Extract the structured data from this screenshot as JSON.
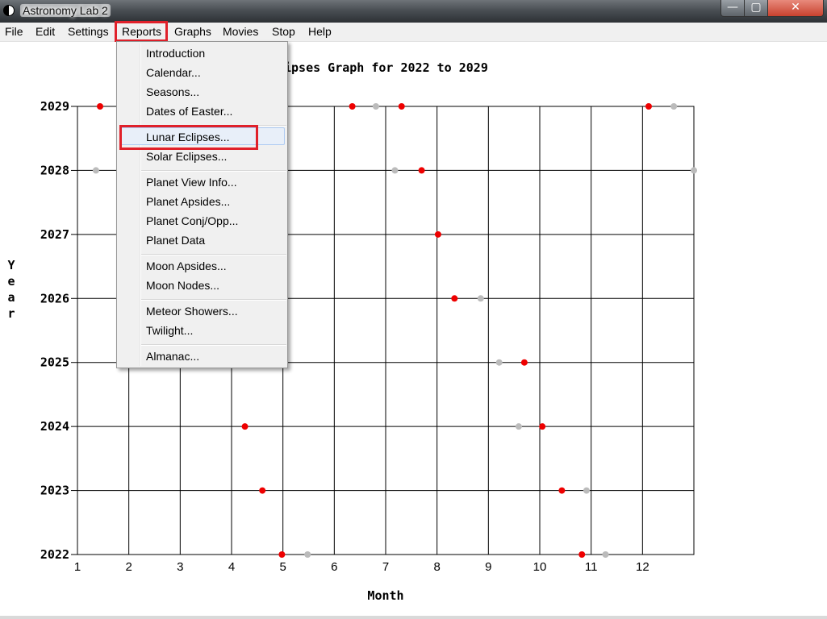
{
  "window": {
    "title": "Astronomy Lab 2",
    "minimize_glyph": "—",
    "maximize_glyph": "▢",
    "close_glyph": "✕"
  },
  "menubar": {
    "items": [
      "File",
      "Edit",
      "Settings",
      "Reports",
      "Graphs",
      "Movies",
      "Stop",
      "Help"
    ],
    "active": "Reports"
  },
  "reports_menu": {
    "groups": [
      [
        "Introduction",
        "Calendar...",
        "Seasons...",
        "Dates of Easter..."
      ],
      [
        "Lunar Eclipses...",
        "Solar Eclipses..."
      ],
      [
        "Planet View Info...",
        "Planet Apsides...",
        "Planet Conj/Opp...",
        "Planet Data"
      ],
      [
        "Moon Apsides...",
        "Moon Nodes..."
      ],
      [
        "Meteor Showers...",
        "Twilight..."
      ],
      [
        "Almanac..."
      ]
    ],
    "highlighted": "Lunar Eclipses..."
  },
  "chart_data": {
    "type": "scatter",
    "title_visible": "ipses Graph for 2022 to 2029",
    "xlabel": "Month",
    "ylabel": "Year",
    "xlim": [
      1,
      13
    ],
    "ylim": [
      2022,
      2029
    ],
    "x_ticks": [
      1,
      2,
      3,
      4,
      5,
      6,
      7,
      8,
      9,
      10,
      11,
      12
    ],
    "y_ticks": [
      2022,
      2023,
      2024,
      2025,
      2026,
      2027,
      2028,
      2029
    ],
    "grid": true,
    "colors": {
      "red": "#ee0000",
      "gray": "#bbbbbb"
    },
    "series": [
      {
        "color": "red",
        "points": [
          [
            4.98,
            2022
          ],
          [
            10.82,
            2022
          ],
          [
            4.6,
            2023
          ],
          [
            10.43,
            2023
          ],
          [
            4.26,
            2024
          ],
          [
            10.05,
            2024
          ],
          [
            9.7,
            2025
          ],
          [
            8.34,
            2026
          ],
          [
            8.02,
            2027
          ],
          [
            7.7,
            2028
          ],
          [
            1.44,
            2029
          ],
          [
            6.35,
            2029
          ],
          [
            7.31,
            2029
          ],
          [
            12.12,
            2029
          ]
        ]
      },
      {
        "color": "gray",
        "points": [
          [
            5.48,
            2022
          ],
          [
            11.28,
            2022
          ],
          [
            10.91,
            2023
          ],
          [
            9.59,
            2024
          ],
          [
            9.21,
            2025
          ],
          [
            8.85,
            2026
          ],
          [
            1.36,
            2028
          ],
          [
            7.18,
            2028
          ],
          [
            13.0,
            2028
          ],
          [
            6.81,
            2029
          ],
          [
            12.61,
            2029
          ]
        ]
      }
    ]
  }
}
